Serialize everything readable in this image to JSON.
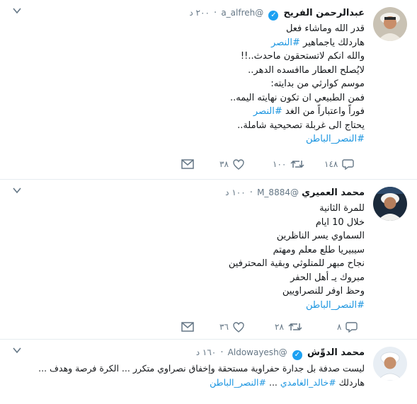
{
  "tweets": [
    {
      "name": "عبدالرحمن الفريح",
      "handle": "@a_alfreh",
      "time": "٢٠٠ د",
      "lines": [
        {
          "text": "قدر الله وماشاء فعل",
          "hashtag": false
        },
        {
          "text": "هاردلك ياجماهير #النصر",
          "hashtag": false
        },
        {
          "text": "والله انكم لاتستحقون ماحدث..!!",
          "hashtag": false
        },
        {
          "text": "لايُصلح العطار ماافسده الدهر..",
          "hashtag": false
        },
        {
          "text": "موسم كوارثي من بدايته:",
          "hashtag": false
        },
        {
          "text": "فمن الطبيعي ان تكون نهايته اليمه..",
          "hashtag": false
        },
        {
          "text": "فوراً واعتباراً من الغد #النصر",
          "hashtag": false
        },
        {
          "text": "يحتاج الى غربلة تصحيحية شاملة..",
          "hashtag": false
        },
        {
          "text": "#النصر_الباطن",
          "hashtag": true
        }
      ],
      "counts": {
        "reply": "١٤٨",
        "retweet": "١٠٠",
        "like": "٣٨"
      }
    },
    {
      "name": "محمد العميري",
      "handle": "@M_8884",
      "time": "١٠٠ د",
      "lines": [
        {
          "text": "للمرة الثانية",
          "hashtag": false
        },
        {
          "text": "خلال 10 ايام",
          "hashtag": false
        },
        {
          "text": "السماوي يسر الناظرين",
          "hashtag": false
        },
        {
          "text": "سيبيريا طلع معلم ومهتم",
          "hashtag": false
        },
        {
          "text": "نجاح مبهر للمتلوثي وبقية المحترفين",
          "hashtag": false
        },
        {
          "text": "مبروك يـ أهل الحفر",
          "hashtag": false
        },
        {
          "text": "وحظ اوفر للنصراويين",
          "hashtag": false
        },
        {
          "text": "#النصر_الباطن",
          "hashtag": true
        }
      ],
      "counts": {
        "reply": "٨",
        "retweet": "٢٨",
        "like": "٣٦"
      }
    },
    {
      "name": "محمد الدوِّش",
      "handle": "@Aldowayesh",
      "time": "١٦٠ د",
      "lines": [
        {
          "text": "ليست صدفة بل جدارة حفراوية مستحقة وإخفاق  نصراوي متكرر ... الكرة فرصة وهدف ...",
          "hashtag": false
        },
        {
          "text": "هاردلك #خالد_الغامدي ... #النصر_الباطن",
          "hashtag": false
        }
      ]
    }
  ],
  "colors": {
    "accent": "#1b95e0",
    "muted": "#657786",
    "verified": "#1da1f2"
  },
  "icons": [
    "chevron-down-icon",
    "verified-badge-icon",
    "reply-icon",
    "retweet-icon",
    "like-icon",
    "dm-icon"
  ]
}
